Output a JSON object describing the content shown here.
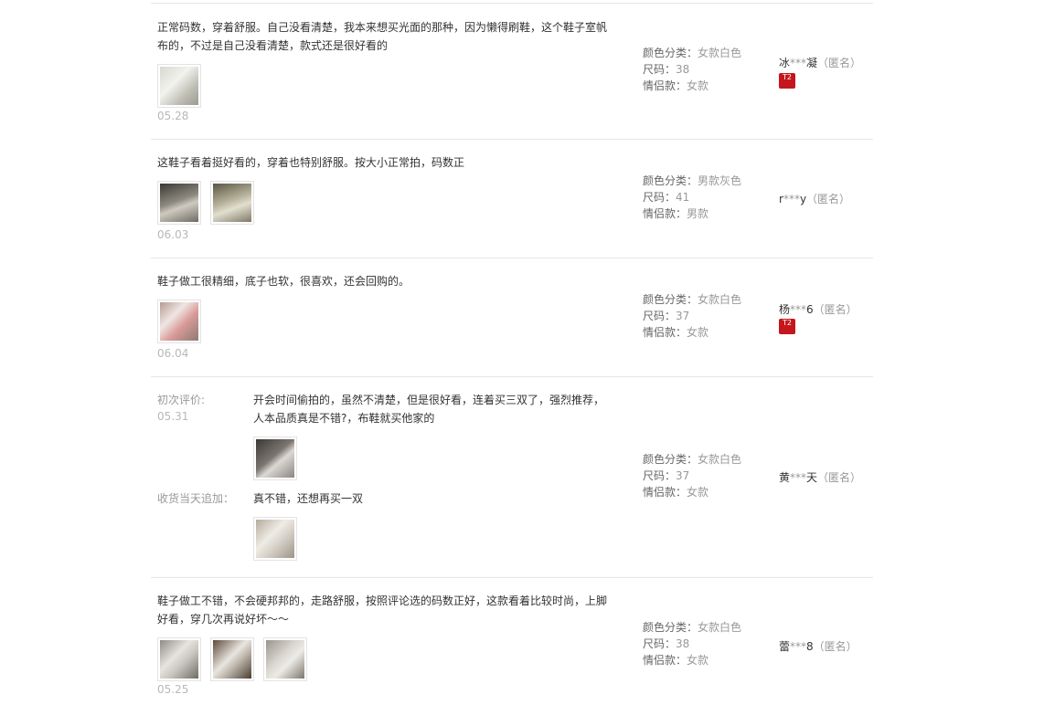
{
  "reviews": [
    {
      "text": "正常码数，穿着舒服。自己没看清楚，我本来想买光面的那种，因为懒得刷鞋，这个鞋子室帆布的，不过是自己没看清楚，款式还是很好看的",
      "date": "05.28",
      "sku": {
        "color_label": "颜色分类：",
        "color_value": "女款白色",
        "size_label": "尺码：",
        "size_value": "38",
        "couple_label": "情侣款：",
        "couple_value": "女款"
      },
      "user": {
        "name_pre": "冰",
        "stars": "***",
        "name_post": "凝",
        "anon": "（匿名）"
      },
      "badge": "T2"
    },
    {
      "text": "这鞋子看着挺好看的，穿着也特别舒服。按大小正常拍，码数正",
      "date": "06.03",
      "sku": {
        "color_label": "颜色分类：",
        "color_value": "男款灰色",
        "size_label": "尺码：",
        "size_value": "41",
        "couple_label": "情侣款：",
        "couple_value": "男款"
      },
      "user": {
        "name_pre": "r",
        "stars": "***",
        "name_post": "y",
        "anon": "（匿名）"
      }
    },
    {
      "text": "鞋子做工很精细，底子也软，很喜欢，还会回购的。",
      "date": "06.04",
      "sku": {
        "color_label": "颜色分类：",
        "color_value": "女款白色",
        "size_label": "尺码：",
        "size_value": "37",
        "couple_label": "情侣款：",
        "couple_value": "女款"
      },
      "user": {
        "name_pre": "杨",
        "stars": "***",
        "name_post": "6",
        "anon": "（匿名）"
      },
      "badge": "T2"
    },
    {
      "first_label": "初次评价:",
      "first_date": "05.31",
      "text": "开会时间偷拍的，虽然不清楚，但是很好看，连着买三双了，强烈推荐，人本品质真是不错?，布鞋就买他家的",
      "append_label": "收货当天追加：",
      "append_text": "真不错，还想再买一双",
      "sku": {
        "color_label": "颜色分类：",
        "color_value": "女款白色",
        "size_label": "尺码：",
        "size_value": "37",
        "couple_label": "情侣款：",
        "couple_value": "女款"
      },
      "user": {
        "name_pre": "黄",
        "stars": "***",
        "name_post": "天",
        "anon": "（匿名）"
      }
    },
    {
      "text": "鞋子做工不错，不会硬邦邦的，走路舒服，按照评论选的码数正好，这款看着比较时尚，上脚好看，穿几次再说好坏～～",
      "date": "05.25",
      "sku": {
        "color_label": "颜色分类：",
        "color_value": "女款白色",
        "size_label": "尺码：",
        "size_value": "38",
        "couple_label": "情侣款：",
        "couple_value": "女款"
      },
      "user": {
        "name_pre": "蕾",
        "stars": "***",
        "name_post": "8",
        "anon": "（匿名）"
      }
    }
  ]
}
